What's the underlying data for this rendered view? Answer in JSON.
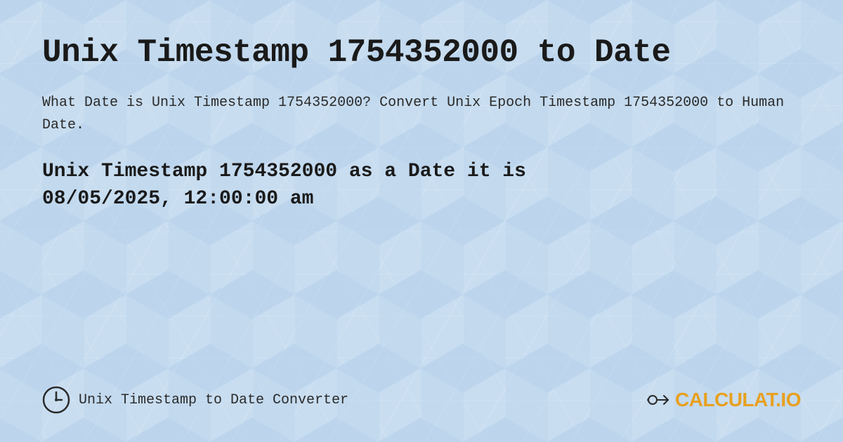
{
  "page": {
    "title": "Unix Timestamp 1754352000 to Date",
    "description": "What Date is Unix Timestamp 1754352000? Convert Unix Epoch Timestamp 1754352000 to Human Date.",
    "result_line1": "Unix Timestamp 1754352000 as a Date it is",
    "result_line2": "08/05/2025, 12:00:00 am",
    "footer": {
      "label": "Unix Timestamp to Date Converter"
    },
    "logo": {
      "text_main": "CALCULAT",
      "text_accent": ".IO"
    }
  }
}
